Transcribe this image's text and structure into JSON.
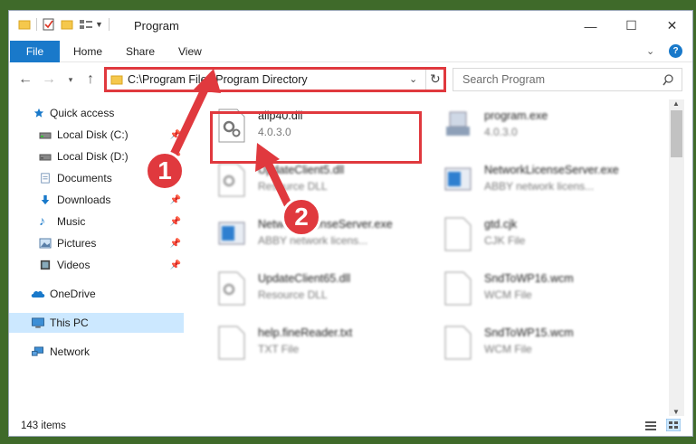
{
  "window": {
    "title": "Program"
  },
  "ribbon": {
    "tabs": [
      "File",
      "Home",
      "Share",
      "View"
    ]
  },
  "address_bar": {
    "path": "C:\\Program Files\\Program Directory"
  },
  "search": {
    "placeholder": "Search Program"
  },
  "sidebar": {
    "items": [
      {
        "label": "Quick access",
        "icon": "star-icon"
      },
      {
        "label": "Local Disk (C:)",
        "icon": "drive-icon"
      },
      {
        "label": "Local Disk (D:)",
        "icon": "drive-icon"
      },
      {
        "label": "Documents",
        "icon": "documents-icon"
      },
      {
        "label": "Downloads",
        "icon": "download-icon"
      },
      {
        "label": "Music",
        "icon": "music-icon"
      },
      {
        "label": "Pictures",
        "icon": "pictures-icon"
      },
      {
        "label": "Videos",
        "icon": "videos-icon"
      },
      {
        "label": "OneDrive",
        "icon": "cloud-icon"
      },
      {
        "label": "This PC",
        "icon": "computer-icon"
      },
      {
        "label": "Network",
        "icon": "network-icon"
      }
    ]
  },
  "files": [
    {
      "name": "allp40.dll",
      "sub": "4.0.3.0"
    },
    {
      "name": "program.exe",
      "sub": "4.0.3.0"
    },
    {
      "name": "UpdateClient5.dll",
      "sub": "Resource DLL"
    },
    {
      "name": "NetworkLicenseServer.exe",
      "sub": "ABBY network licens..."
    },
    {
      "name": "NetworkLicenseServer.exe",
      "sub": "ABBY network licens..."
    },
    {
      "name": "gtd.cjk",
      "sub": "CJK File"
    },
    {
      "name": "UpdateClient65.dll",
      "sub": "Resource DLL"
    },
    {
      "name": "SndToWP16.wcm",
      "sub": "WCM File"
    },
    {
      "name": "help.fineReader.txt",
      "sub": "TXT File"
    },
    {
      "name": "SndToWP15.wcm",
      "sub": "WCM File"
    }
  ],
  "status": {
    "item_count": "143 items"
  },
  "annotations": {
    "step1": "1",
    "step2": "2"
  },
  "colors": {
    "accent": "#1979ca",
    "highlight": "#e0393e",
    "selection": "#cce8ff"
  }
}
